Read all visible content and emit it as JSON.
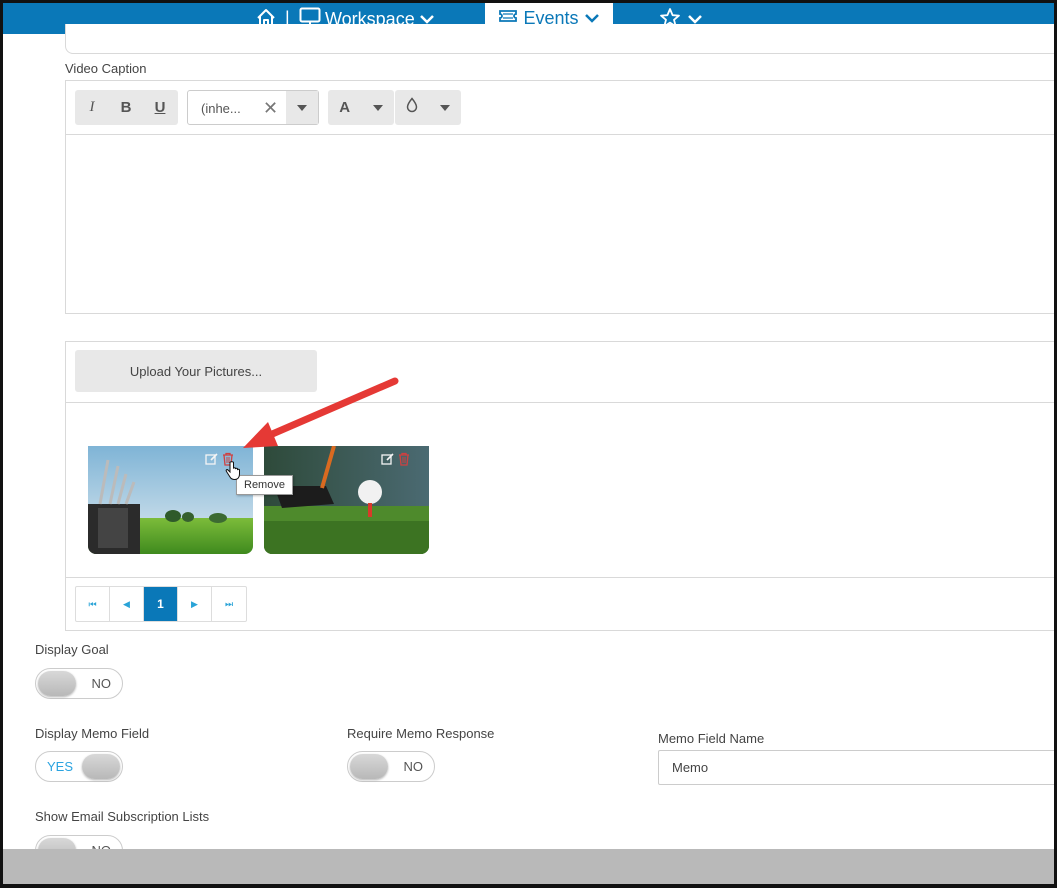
{
  "nav": {
    "workspace_label": "Workspace",
    "events_label": "Events",
    "separator": "|",
    "accent_color": "#0a78b8"
  },
  "editor": {
    "caption_label": "Video Caption",
    "italic": "I",
    "bold": "B",
    "underline": "U",
    "font_value": "(inhe...",
    "font_clear": "✕",
    "color_letter": "A"
  },
  "gallery": {
    "upload_label": "Upload Your Pictures...",
    "tooltip": "Remove",
    "images": [
      {
        "subject": "golf bag on course"
      },
      {
        "subject": "golf ball on tee"
      }
    ]
  },
  "pager": {
    "first": "⏮",
    "prev": "◀",
    "current_page": "1",
    "next": "▶",
    "last": "⏭"
  },
  "form": {
    "display_goal": {
      "label": "Display Goal",
      "state": "NO"
    },
    "display_memo": {
      "label": "Display Memo Field",
      "state": "YES"
    },
    "require_memo": {
      "label": "Require Memo Response",
      "state": "NO"
    },
    "memo_field_name": {
      "label": "Memo Field Name",
      "value": "Memo"
    },
    "email_subscription": {
      "label": "Show Email Subscription Lists",
      "state": "NO"
    }
  }
}
